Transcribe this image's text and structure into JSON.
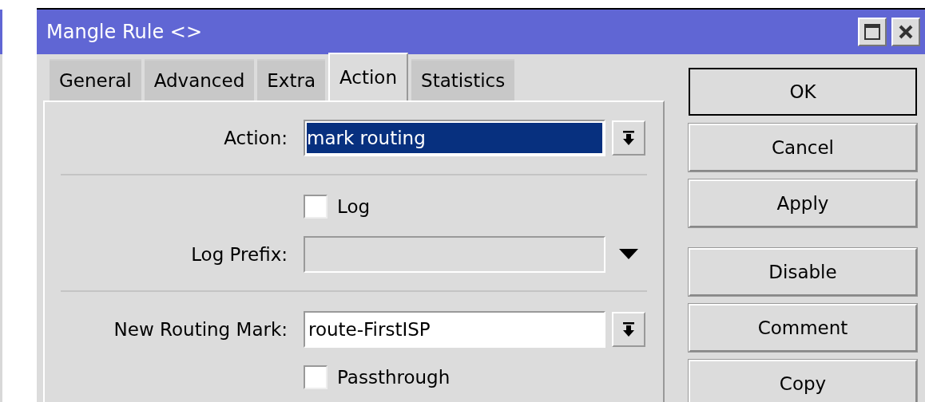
{
  "window": {
    "title": "Mangle Rule <>",
    "controls": [
      {
        "kind": "maximize"
      },
      {
        "kind": "close"
      }
    ]
  },
  "tabs": [
    {
      "label": "General",
      "selected": false
    },
    {
      "label": "Advanced",
      "selected": false
    },
    {
      "label": "Extra",
      "selected": false
    },
    {
      "label": "Action",
      "selected": true
    },
    {
      "label": "Statistics",
      "selected": false
    }
  ],
  "sections": [
    {
      "rows": [
        {
          "kind": "select",
          "label": "Action:",
          "value": "mark routing",
          "highlighted": true
        }
      ]
    },
    {
      "rows": [
        {
          "kind": "checkbox",
          "text": "Log",
          "checked": false
        },
        {
          "kind": "combo",
          "label": "Log Prefix:"
        }
      ]
    },
    {
      "rows": [
        {
          "kind": "select",
          "label": "New Routing Mark:",
          "value": "route-FirstISP",
          "highlighted": false
        },
        {
          "kind": "checkbox",
          "text": "Passthrough",
          "checked": false
        }
      ]
    }
  ],
  "button_groups": [
    [
      {
        "label": "OK",
        "default": true
      },
      {
        "label": "Cancel",
        "default": false
      },
      {
        "label": "Apply",
        "default": false
      }
    ],
    [
      {
        "label": "Disable",
        "default": false
      },
      {
        "label": "Comment",
        "default": false
      },
      {
        "label": "Copy",
        "default": false
      }
    ]
  ]
}
